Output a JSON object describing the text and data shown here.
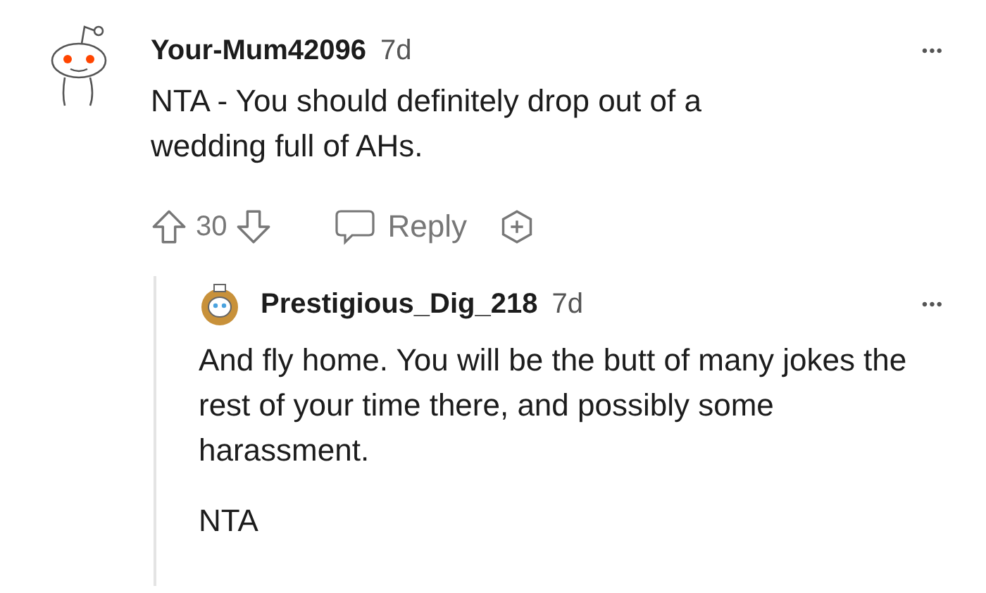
{
  "comment": {
    "author": "Your-Mum42096",
    "age": "7d",
    "more": "•••",
    "body": "NTA - You should definitely drop out of a wedding full of AHs.",
    "votes": "30",
    "reply_label": "Reply"
  },
  "reply": {
    "author": "Prestigious_Dig_218",
    "age": "7d",
    "more": "•••",
    "paragraphs": [
      "And fly home. You will be the butt of many jokes the rest of your time there, and possibly some harassment.",
      "NTA"
    ]
  }
}
